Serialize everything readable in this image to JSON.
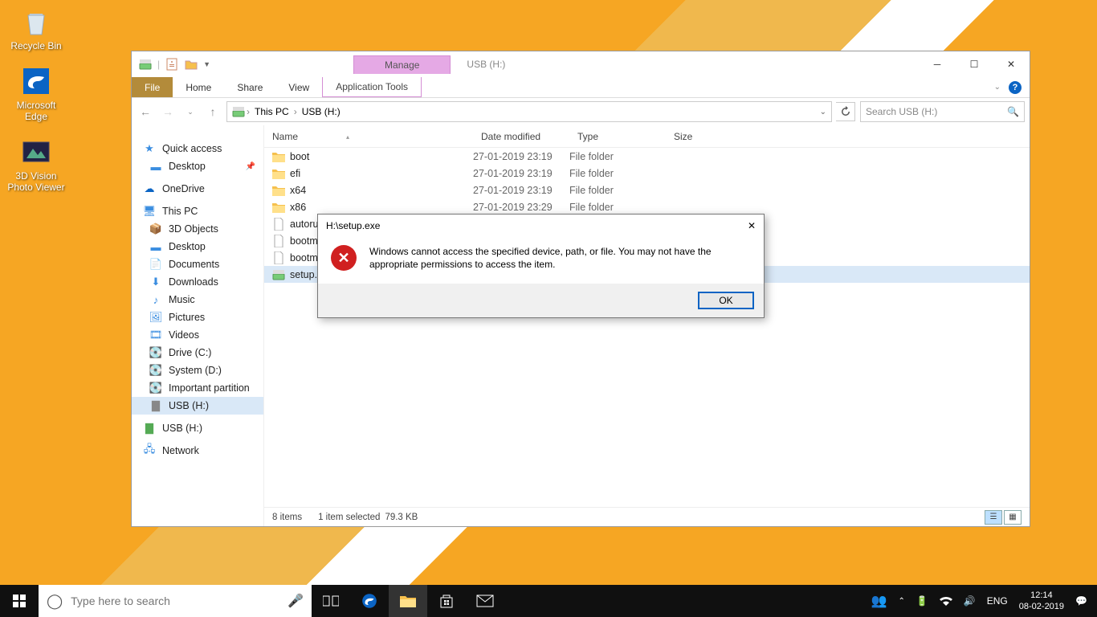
{
  "desktop": {
    "icons": [
      {
        "label": "Recycle Bin"
      },
      {
        "label": "Microsoft Edge"
      },
      {
        "label": "3D Vision Photo Viewer"
      }
    ]
  },
  "taskbar": {
    "search_placeholder": "Type here to search",
    "lang": "ENG",
    "time": "12:14",
    "date": "08-02-2019"
  },
  "explorer": {
    "manage": "Manage",
    "title": "USB (H:)",
    "tabs": {
      "file": "File",
      "home": "Home",
      "share": "Share",
      "view": "View",
      "apptools": "Application Tools"
    },
    "breadcrumb": [
      "This PC",
      "USB (H:)"
    ],
    "search_placeholder": "Search USB (H:)",
    "columns": {
      "name": "Name",
      "date": "Date modified",
      "type": "Type",
      "size": "Size"
    },
    "nav": {
      "quick": "Quick access",
      "desktop": "Desktop",
      "onedrive": "OneDrive",
      "thispc": "This PC",
      "items": [
        "3D Objects",
        "Desktop",
        "Documents",
        "Downloads",
        "Music",
        "Pictures",
        "Videos",
        "Drive (C:)",
        "System (D:)",
        "Important partition",
        "USB (H:)"
      ],
      "usb2": "USB (H:)",
      "network": "Network"
    },
    "files": [
      {
        "name": "boot",
        "date": "27-01-2019 23:19",
        "type": "File folder",
        "size": "",
        "icon": "folder"
      },
      {
        "name": "efi",
        "date": "27-01-2019 23:19",
        "type": "File folder",
        "size": "",
        "icon": "folder"
      },
      {
        "name": "x64",
        "date": "27-01-2019 23:19",
        "type": "File folder",
        "size": "",
        "icon": "folder"
      },
      {
        "name": "x86",
        "date": "27-01-2019 23:29",
        "type": "File folder",
        "size": "",
        "icon": "folder"
      },
      {
        "name": "autorun",
        "date": "",
        "type": "",
        "size": "",
        "icon": "file"
      },
      {
        "name": "bootmg",
        "date": "",
        "type": "",
        "size": "",
        "icon": "file"
      },
      {
        "name": "bootmg",
        "date": "",
        "type": "",
        "size": "",
        "icon": "file"
      },
      {
        "name": "setup.e",
        "date": "",
        "type": "",
        "size": "",
        "icon": "app",
        "selected": true
      }
    ],
    "status": {
      "items": "8 items",
      "selected": "1 item selected",
      "size": "79.3 KB"
    }
  },
  "dialog": {
    "title": "H:\\setup.exe",
    "message": "Windows cannot access the specified device, path, or file. You may not have the appropriate permissions to access the item.",
    "ok": "OK"
  }
}
